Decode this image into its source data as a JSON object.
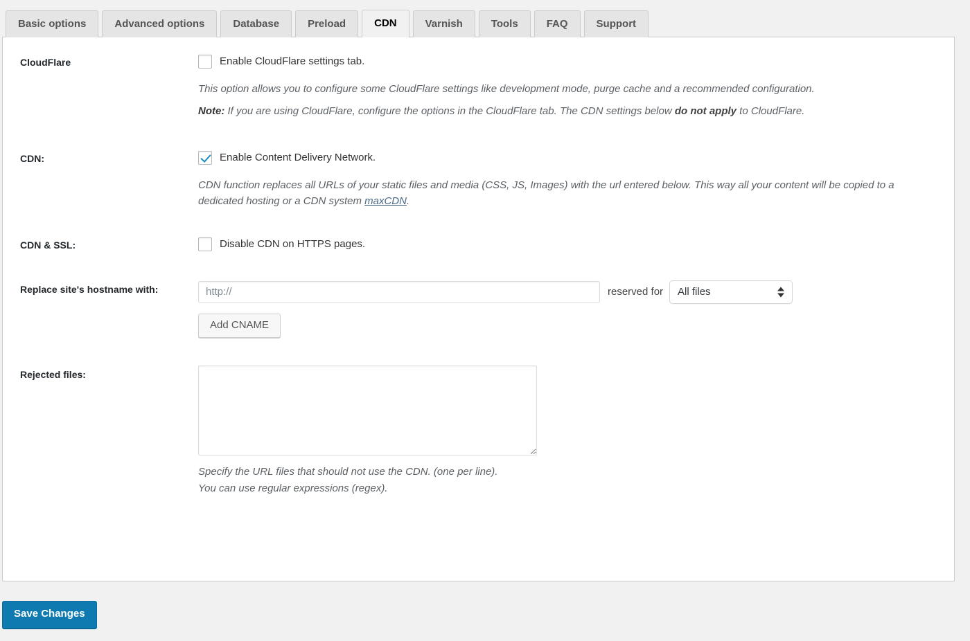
{
  "tabs": [
    {
      "label": "Basic options",
      "active": false
    },
    {
      "label": "Advanced options",
      "active": false
    },
    {
      "label": "Database",
      "active": false
    },
    {
      "label": "Preload",
      "active": false
    },
    {
      "label": "CDN",
      "active": true
    },
    {
      "label": "Varnish",
      "active": false
    },
    {
      "label": "Tools",
      "active": false
    },
    {
      "label": "FAQ",
      "active": false
    },
    {
      "label": "Support",
      "active": false
    }
  ],
  "rows": {
    "cloudflare": {
      "label": "CloudFlare",
      "checkbox_label": "Enable CloudFlare settings tab.",
      "checked": false,
      "desc_1": "This option allows you to configure some CloudFlare settings like development mode, purge cache and a recommended configuration.",
      "note_label": "Note:",
      "note_part_1": " If you are using CloudFlare, configure the options in the CloudFlare tab. The CDN settings below ",
      "note_strong": "do not apply",
      "note_part_2": " to CloudFlare."
    },
    "cdn": {
      "label": "CDN:",
      "checkbox_label": "Enable Content Delivery Network.",
      "checked": true,
      "desc_part_1": "CDN function replaces all URLs of your static files and media (CSS, JS, Images) with the url entered below. This way all your content will be copied to a dedicated hosting or a CDN system ",
      "desc_link": "maxCDN",
      "desc_part_2": "."
    },
    "cdn_ssl": {
      "label": "CDN & SSL:",
      "checkbox_label": "Disable CDN on HTTPS pages.",
      "checked": false
    },
    "hostname": {
      "label": "Replace site's hostname with:",
      "input_value": "",
      "input_placeholder": "http://",
      "reserved_label": "reserved for",
      "select_value": "All files",
      "select_options": [
        "All files"
      ],
      "add_cname_label": "Add CNAME"
    },
    "rejected": {
      "label": "Rejected files:",
      "textarea_value": "",
      "desc_line_1": "Specify the URL files that should not use the CDN. (one per line).",
      "desc_line_2": "You can use regular expressions (regex)."
    }
  },
  "footer": {
    "save_label": "Save Changes"
  },
  "colors": {
    "accent": "#0e7ab0",
    "checkbox_check": "#1e8cbe",
    "link": "#4a6a86",
    "page_bg": "#f1f1f1"
  }
}
